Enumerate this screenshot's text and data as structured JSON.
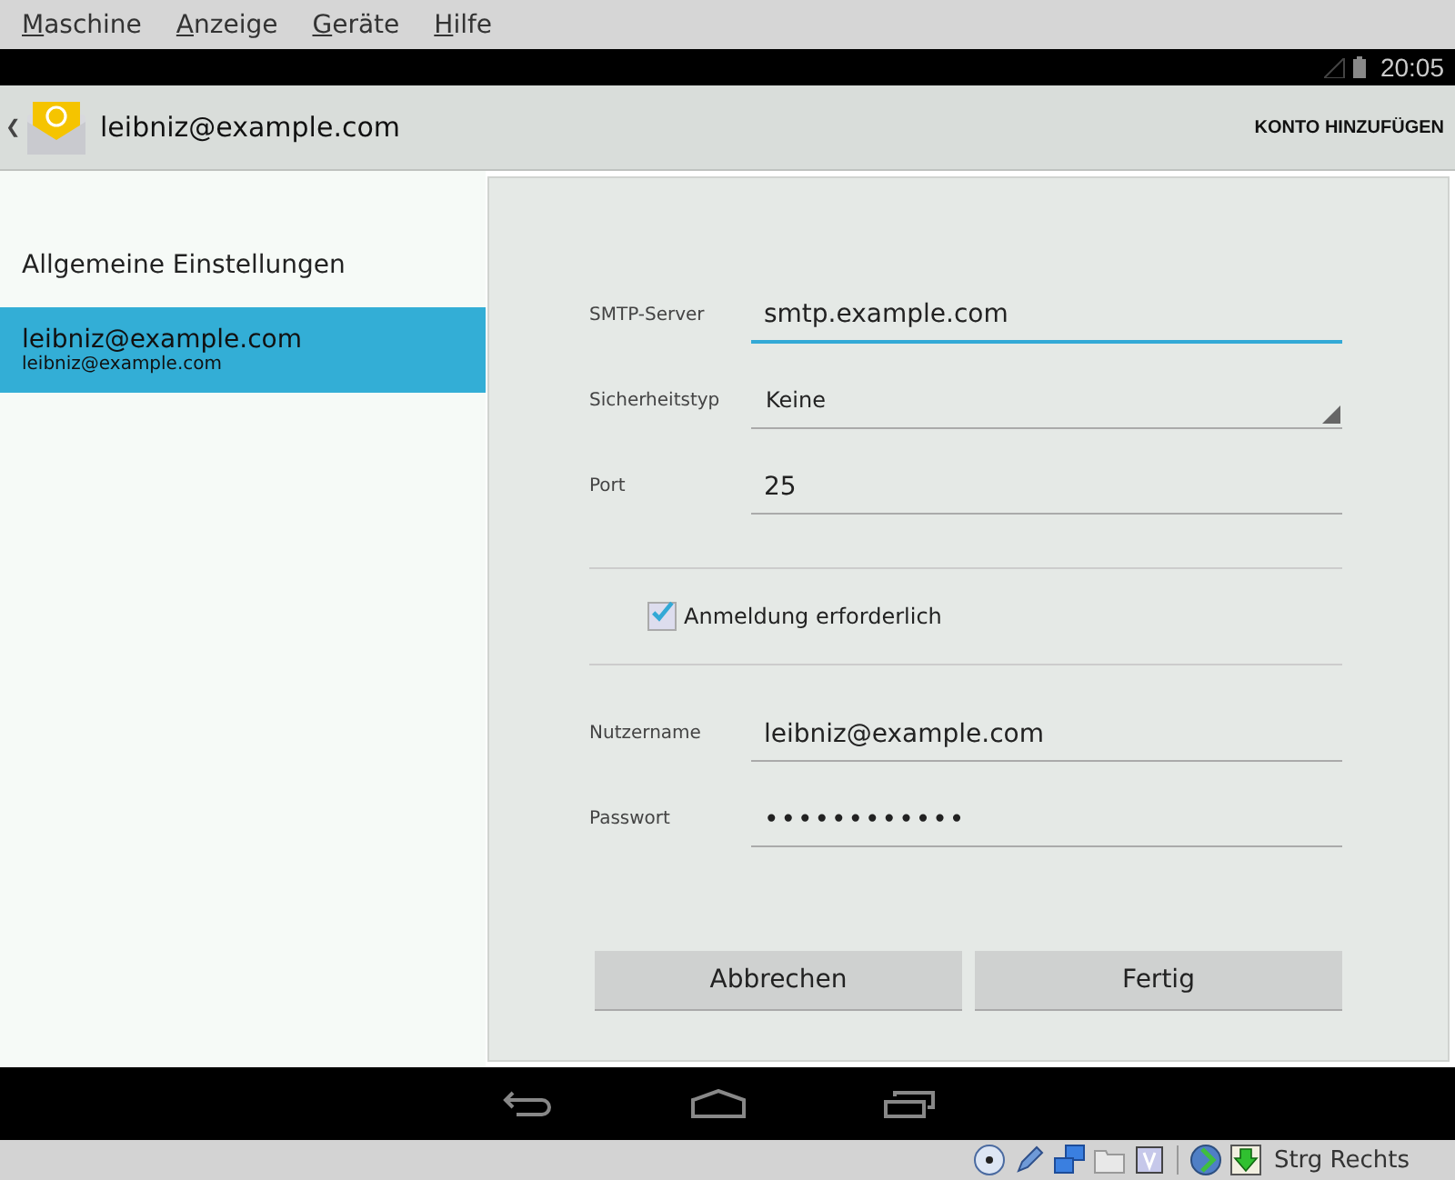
{
  "menu": [
    {
      "label": "Maschine"
    },
    {
      "label": "Anzeige"
    },
    {
      "label": "Geräte"
    },
    {
      "label": "Hilfe"
    }
  ],
  "status_bar": {
    "time": "20:05"
  },
  "action_bar": {
    "back": "❮",
    "title": "leibniz@example.com",
    "action": "KONTO HINZUFÜGEN"
  },
  "sidebar": {
    "items": [
      {
        "title": "Allgemeine Einstellungen",
        "selected": false
      },
      {
        "title": "leibniz@example.com",
        "subtitle": "leibniz@example.com",
        "selected": true
      }
    ]
  },
  "form": {
    "fields": [
      {
        "kind": "text",
        "label": "SMTP-Server",
        "value": "smtp.example.com",
        "focused": true
      },
      {
        "kind": "select",
        "label": "Sicherheitstyp",
        "value": "Keine"
      },
      {
        "kind": "text",
        "label": "Port",
        "value": "25",
        "focused": false
      },
      {
        "kind": "checkbox",
        "label": "Anmeldung erforderlich",
        "checked": true
      },
      {
        "kind": "text",
        "label": "Nutzername",
        "value": "leibniz@example.com",
        "focused": false
      },
      {
        "kind": "password",
        "label": "Passwort",
        "value": "••••••••••••",
        "focused": false
      }
    ],
    "buttons": [
      "Abbrechen",
      "Fertig"
    ]
  },
  "host_status": {
    "hotkey": "Strg Rechts"
  }
}
